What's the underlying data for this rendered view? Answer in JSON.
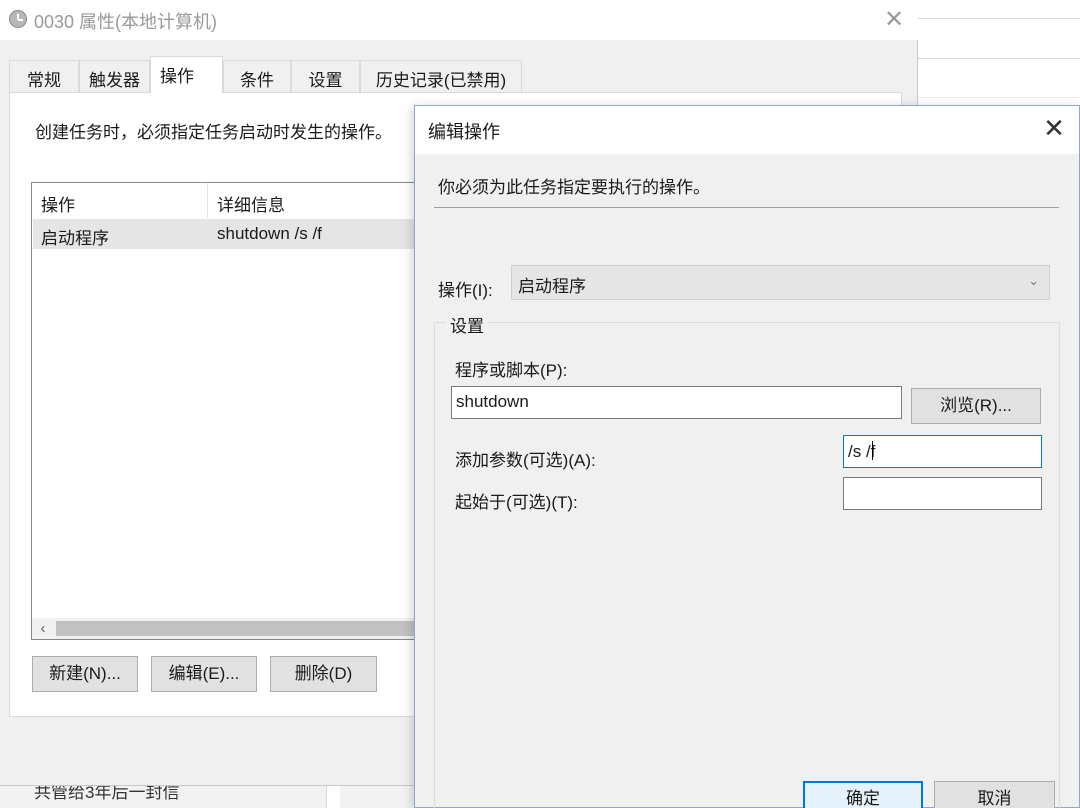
{
  "background": {
    "bottom_text": "共管给3年后一封信"
  },
  "properties_window": {
    "title": "0030 属性(本地计算机)",
    "tabs": [
      "常规",
      "触发器",
      "操作",
      "条件",
      "设置",
      "历史记录(已禁用)"
    ],
    "active_tab": "操作",
    "description": "创建任务时，必须指定任务启动时发生的操作。",
    "list": {
      "columns": [
        "操作",
        "详细信息"
      ],
      "rows": [
        {
          "action": "启动程序",
          "details": "shutdown /s /f"
        }
      ]
    },
    "buttons": {
      "new": "新建(N)...",
      "edit": "编辑(E)...",
      "delete": "删除(D)"
    }
  },
  "edit_dialog": {
    "title": "编辑操作",
    "intro": "你必须为此任务指定要执行的操作。",
    "action_label": "操作(I):",
    "action_value": "启动程序",
    "settings_group": "设置",
    "program_label": "程序或脚本(P):",
    "program_value": "shutdown",
    "browse_button": "浏览(R)...",
    "args_label": "添加参数(可选)(A):",
    "args_value": "/s /f",
    "start_in_label": "起始于(可选)(T):",
    "start_in_value": "",
    "ok_button": "确定",
    "cancel_button": "取消"
  },
  "colors": {
    "focus_accent": "#0078d7",
    "dialog_body": "#f0f0f0",
    "selected_row": "#e5e5e5"
  }
}
